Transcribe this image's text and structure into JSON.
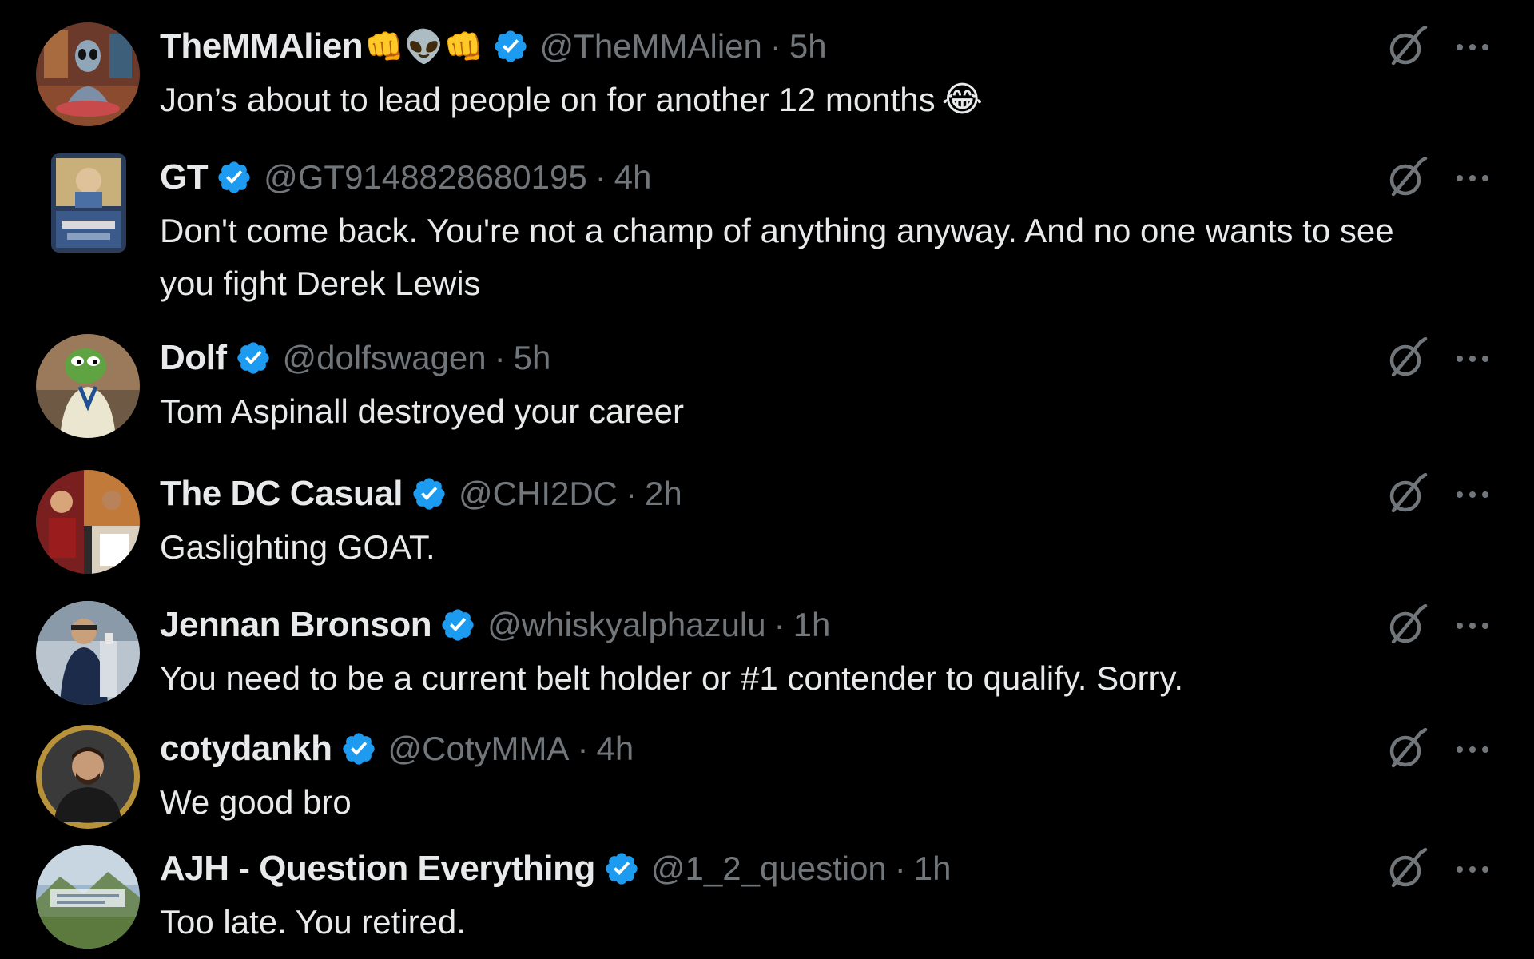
{
  "colors": {
    "background": "#000000",
    "text": "#e7e9ea",
    "muted": "#71767b",
    "verified": "#1d9bf0"
  },
  "replies": [
    {
      "name": "TheMMAlien",
      "name_emoji": "👊👽👊",
      "handle": "@TheMMAlien",
      "time": "5h",
      "text": "Jon’s about to lead people on for another 12 months",
      "text_emoji": "😂"
    },
    {
      "name": "GT",
      "handle": "@GT9148828680195",
      "time": "4h",
      "text": "Don't come back. You're not a champ of anything anyway. And no one wants to see you fight Derek Lewis"
    },
    {
      "name": "Dolf",
      "handle": "@dolfswagen",
      "time": "5h",
      "text": "Tom Aspinall destroyed your career"
    },
    {
      "name": "The DC Casual",
      "handle": "@CHI2DC",
      "time": "2h",
      "text": "Gaslighting GOAT."
    },
    {
      "name": "Jennan Bronson",
      "handle": "@whiskyalphazulu",
      "time": "1h",
      "text": "You need to be a current belt holder or #1 contender to qualify. Sorry."
    },
    {
      "name": "cotydankh",
      "handle": "@CotyMMA",
      "time": "4h",
      "text": "We good bro"
    },
    {
      "name": "AJH - Question Everything",
      "handle": "@1_2_question",
      "time": "1h",
      "text": "Too late. You retired."
    }
  ],
  "separator": "·",
  "icons": {
    "verified": "verified-badge-icon",
    "grok": "grok-icon",
    "more": "more-options-icon"
  }
}
